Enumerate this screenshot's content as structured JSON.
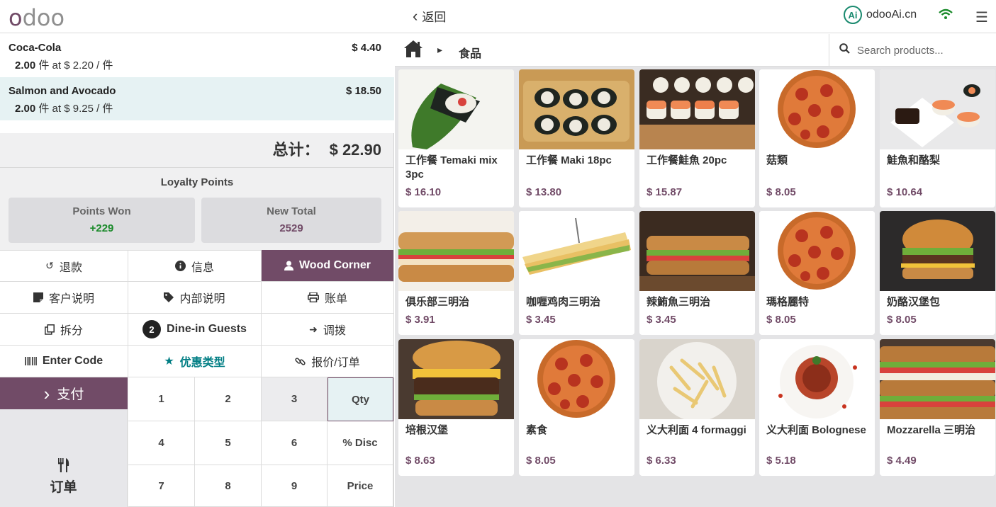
{
  "header": {
    "logo": "odoo",
    "back_label": "返回",
    "site_badge": "Ai",
    "site_name": "odooAi.cn",
    "icons": [
      "chevron-left-icon",
      "wifi-icon",
      "hamburger-menu-icon"
    ]
  },
  "order": {
    "lines": [
      {
        "name": "Coca-Cola",
        "price": "$ 4.40",
        "qty": "2.00",
        "unit_text": "件 at $ 2.20 / 件"
      },
      {
        "name": "Salmon and Avocado",
        "price": "$ 18.50",
        "qty": "2.00",
        "unit_text": "件 at $ 9.25 / 件"
      }
    ],
    "total_label": "总计：",
    "total_value": "$ 22.90"
  },
  "loyalty": {
    "title": "Loyalty Points",
    "won_label": "Points Won",
    "won_value": "+229",
    "new_total_label": "New Total",
    "new_total_value": "2529",
    "colors": {
      "won": "#1a8a2a",
      "new_total": "#714b67"
    }
  },
  "controls": {
    "refund": "退款",
    "info": "信息",
    "customer": "Wood Corner",
    "customer_note": "客户说明",
    "internal_note": "内部说明",
    "bill": "账单",
    "split": "拆分",
    "guests_count": "2",
    "guests_label": "Dine-in Guests",
    "transfer": "调拨",
    "enter_code": "Enter Code",
    "promo": "优惠类型",
    "quotation": "报价/订单",
    "pay": "支付",
    "orders": "订单"
  },
  "numpad": {
    "keys": [
      "1",
      "2",
      "3",
      "Qty",
      "4",
      "5",
      "6",
      "% Disc",
      "7",
      "8",
      "9",
      "Price"
    ]
  },
  "products": {
    "home_icon": "home-icon",
    "category": "食品",
    "search_placeholder": "Search products...",
    "items": [
      {
        "name": "工作餐 Temaki mix 3pc",
        "price": "$ 16.10"
      },
      {
        "name": "工作餐 Maki 18pc",
        "price": "$ 13.80"
      },
      {
        "name": "工作餐鮭魚 20pc",
        "price": "$ 15.87"
      },
      {
        "name": "菇類",
        "price": "$ 8.05"
      },
      {
        "name": "鮭魚和酪梨",
        "price": "$ 10.64"
      },
      {
        "name": "俱乐部三明治",
        "price": "$ 3.91"
      },
      {
        "name": "咖喱鸡肉三明治",
        "price": "$ 3.45"
      },
      {
        "name": "辣鮪魚三明治",
        "price": "$ 3.45"
      },
      {
        "name": "瑪格麗特",
        "price": "$ 8.05"
      },
      {
        "name": "奶酪汉堡包",
        "price": "$ 8.05"
      },
      {
        "name": "培根汉堡",
        "price": "$ 8.63"
      },
      {
        "name": "素食",
        "price": "$ 8.05"
      },
      {
        "name": "义大利面 4 formaggi",
        "price": "$ 6.33"
      },
      {
        "name": "义大利面 Bolognese",
        "price": "$ 5.18"
      },
      {
        "name": "Mozzarella 三明治",
        "price": "$ 4.49"
      }
    ]
  },
  "colors": {
    "brand": "#714b67",
    "teal": "#017e84",
    "selected_line": "#e6f2f3"
  }
}
